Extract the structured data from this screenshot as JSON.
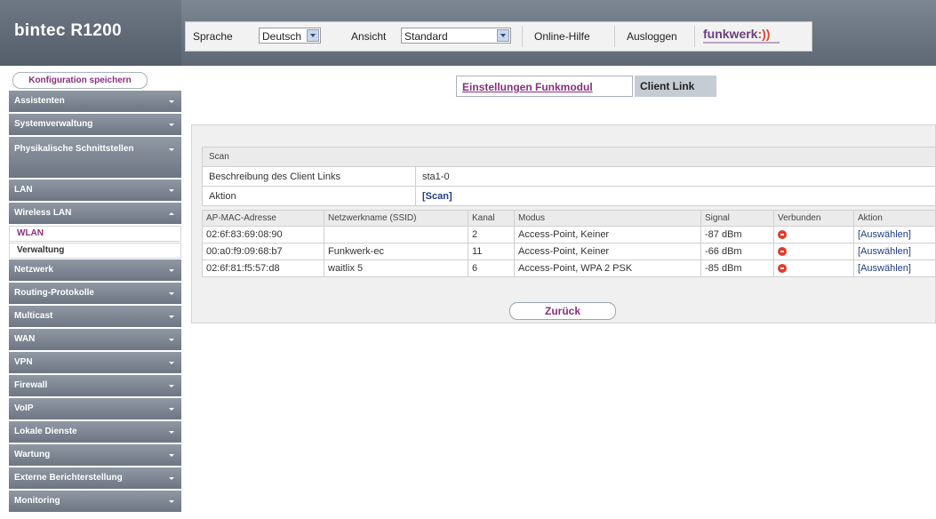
{
  "brand": {
    "title": "bintec R1200"
  },
  "toolbar": {
    "language_label": "Sprache",
    "language_value": "Deutsch",
    "view_label": "Ansicht",
    "view_value": "Standard",
    "help_label": "Online-Hilfe",
    "logout_label": "Ausloggen",
    "logo_text": "funkwerk"
  },
  "sidebar": {
    "save_label": "Konfiguration speichern",
    "items": [
      {
        "label": "Assistenten"
      },
      {
        "label": "Systemverwaltung"
      },
      {
        "label": "Physikalische Schnittstellen"
      },
      {
        "label": "LAN"
      },
      {
        "label": "Wireless LAN"
      },
      {
        "label": "Netzwerk"
      },
      {
        "label": "Routing-Protokolle"
      },
      {
        "label": "Multicast"
      },
      {
        "label": "WAN"
      },
      {
        "label": "VPN"
      },
      {
        "label": "Firewall"
      },
      {
        "label": "VoIP"
      },
      {
        "label": "Lokale Dienste"
      },
      {
        "label": "Wartung"
      },
      {
        "label": "Externe Berichterstellung"
      },
      {
        "label": "Monitoring"
      }
    ],
    "subitems": [
      {
        "label": "WLAN"
      },
      {
        "label": "Verwaltung"
      }
    ]
  },
  "tabs": {
    "settings": "Einstellungen Funkmodul",
    "client_link": "Client Link"
  },
  "form": {
    "section": "Scan",
    "description_label": "Beschreibung des Client Links",
    "description_value": "sta1-0",
    "action_label": "Aktion",
    "action_value": "[Scan]"
  },
  "table": {
    "headers": [
      "AP-MAC-Adresse",
      "Netzwerkname (SSID)",
      "Kanal",
      "Modus",
      "Signal",
      "Verbunden",
      "Aktion"
    ],
    "rows": [
      {
        "mac": "02:6f:83:69:08:90",
        "ssid": "",
        "channel": "2",
        "mode": "Access-Point,  Keiner",
        "signal": "-87  dBm",
        "action": "[Auswählen]"
      },
      {
        "mac": "00:a0:f9:09:68:b7",
        "ssid": "Funkwerk-ec",
        "channel": "11",
        "mode": "Access-Point,  Keiner",
        "signal": "-66  dBm",
        "action": "[Auswählen]"
      },
      {
        "mac": "02:6f:81:f5:57:d8",
        "ssid": "waitlix 5",
        "channel": "6",
        "mode": "Access-Point,  WPA 2 PSK",
        "signal": "-85  dBm",
        "action": "[Auswählen]"
      }
    ]
  },
  "back_label": "Zurück",
  "colors": {
    "accent": "#8a2f7e",
    "nav_bg": "#7b8490",
    "status_red": "#e23a26",
    "link": "#1f3c8a"
  }
}
